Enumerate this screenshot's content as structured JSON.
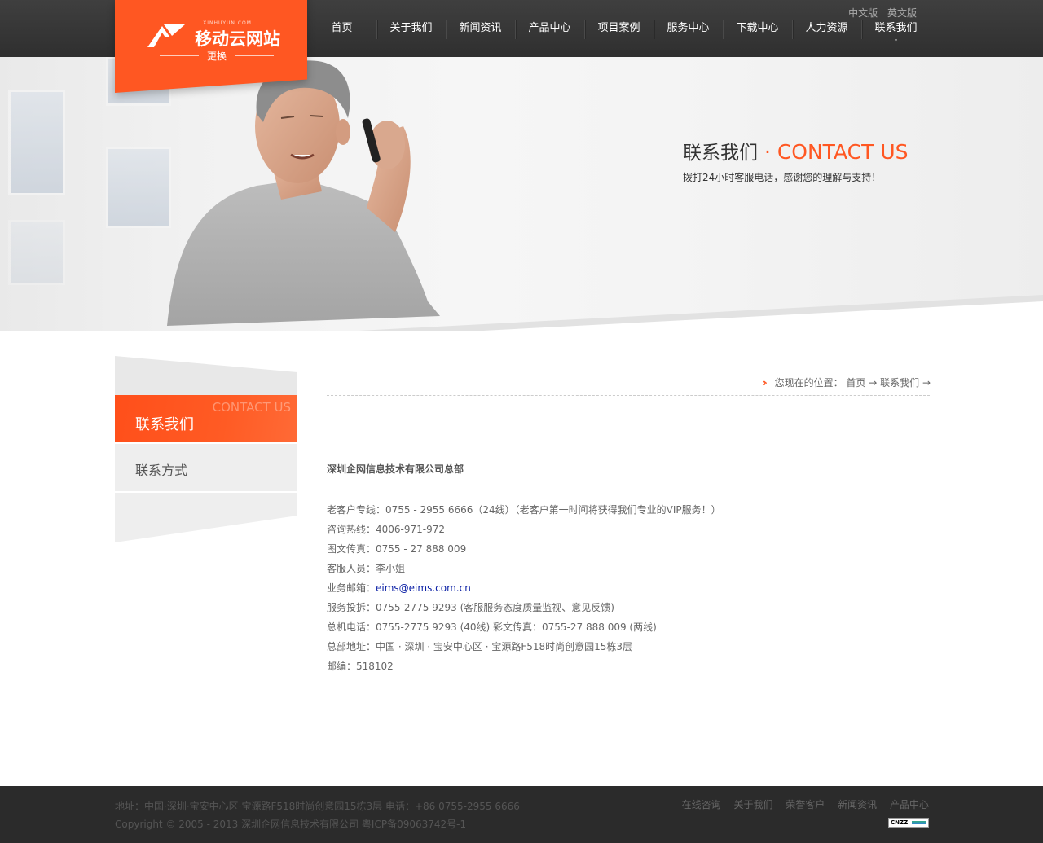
{
  "header": {
    "logo_small": "XINHUYUN.COM",
    "logo_name": "移动云网站",
    "logo_switch": "更换",
    "lang": [
      "中文版",
      "英文版"
    ],
    "nav": [
      "首页",
      "关于我们",
      "新闻资讯",
      "产品中心",
      "项目案例",
      "服务中心",
      "下载中心",
      "人力资源",
      "联系我们"
    ],
    "nav_caret": "˅",
    "active_nav": "联系我们",
    "accent_color": "#ff5722"
  },
  "banner": {
    "title_cn": "联系我们",
    "title_sep": " · ",
    "title_en": "CONTACT US",
    "subtitle": "拨打24小时客服电话，感谢您的理解与支持！"
  },
  "sidebar": {
    "active_en": "CONTACT US",
    "active_cn": "联系我们",
    "items": [
      "联系方式"
    ]
  },
  "breadcrumb": {
    "prefix": "您现在的位置：",
    "home": "首页",
    "arrow": " → ",
    "current": "联系我们",
    "tail": " →"
  },
  "content": {
    "company": "深圳企网信息技术有限公司总部",
    "rows": [
      "老客户专线：0755 - 2955 6666（24线）（老客户第一时间将获得我们专业的VIP服务！）",
      "咨询热线：4006-971-972",
      "图文传真：0755 - 27 888 009",
      "客服人员：李小姐"
    ],
    "email_label": "业务邮箱：",
    "email": "eims@eims.com.cn",
    "rows2": [
      "服务投拆：0755-2775 9293 (客服服务态度质量监视、意见反馈)",
      "总机电话：0755-2775 9293 (40线) 彩文传真：0755-27 888 009 (两线)",
      "总部地址：中国 · 深圳 · 宝安中心区 · 宝源路F518时尚创意园15栋3层",
      "邮编：518102"
    ]
  },
  "footer": {
    "address": "地址：中国·深圳·宝安中心区·宝源路F518时尚创意园15栋3层 电话：+86 0755-2955 6666",
    "copyright": "Copyright © 2005 - 2013 深圳企网信息技术有限公司 粤ICP备09063742号-1",
    "links": [
      "在线咨询",
      "关于我们",
      "荣誉客户",
      "新闻资讯",
      "产品中心"
    ],
    "badge": "CNZZ"
  }
}
